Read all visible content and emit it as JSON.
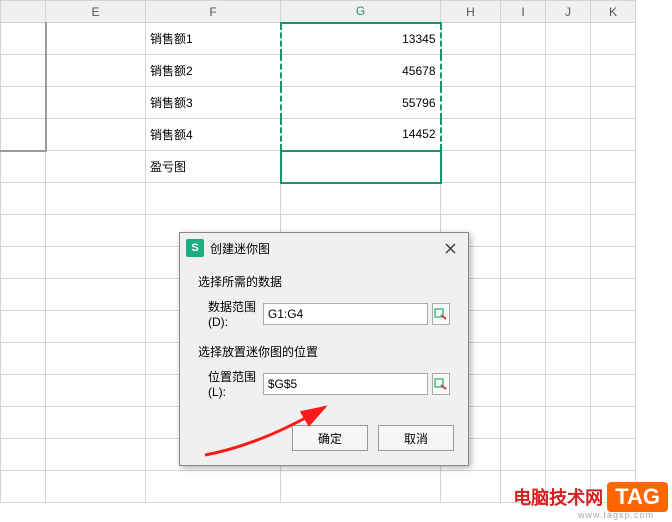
{
  "columns": {
    "E": "E",
    "F": "F",
    "G": "G",
    "H": "H",
    "I": "I",
    "J": "J",
    "K": "K"
  },
  "rows": {
    "r1": {
      "label": "销售额1",
      "value": "13345"
    },
    "r2": {
      "label": "销售额2",
      "value": "45678"
    },
    "r3": {
      "label": "销售额3",
      "value": "55796"
    },
    "r4": {
      "label": "销售额4",
      "value": "14452"
    },
    "r5": {
      "label": "盈亏图",
      "value": ""
    }
  },
  "dialog": {
    "title": "创建迷你图",
    "section1": "选择所需的数据",
    "dataRangeLabel": "数据范围(D):",
    "dataRangeValue": "G1:G4",
    "section2": "选择放置迷你图的位置",
    "locRangeLabel": "位置范围(L):",
    "locRangeValue": "$G$5",
    "ok": "确定",
    "cancel": "取消"
  },
  "branding": {
    "watermark": "",
    "siteName": "电脑技术网",
    "tag": "TAG",
    "url": "www.tagxp.com"
  }
}
